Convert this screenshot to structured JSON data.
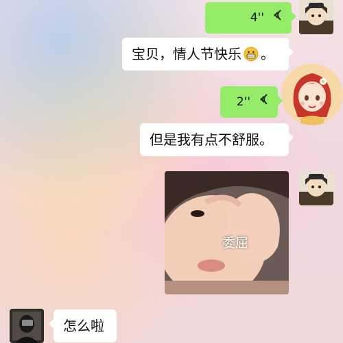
{
  "messages": [
    {
      "type": "voice",
      "side": "right",
      "duration": "4''"
    },
    {
      "type": "text",
      "side": "right",
      "text": "宝贝，情人节快乐",
      "emoji": "grinning-face",
      "suffix": "。"
    },
    {
      "type": "voice",
      "side": "right",
      "duration": "2''"
    },
    {
      "type": "text",
      "side": "right",
      "text": "但是我有点不舒服。"
    },
    {
      "type": "sticker",
      "side": "right",
      "caption": "委屈"
    },
    {
      "type": "text",
      "side": "left",
      "text": "怎么啦"
    }
  ],
  "colors": {
    "sent_bubble": "#95ec69",
    "received_bubble": "#ffffff"
  }
}
